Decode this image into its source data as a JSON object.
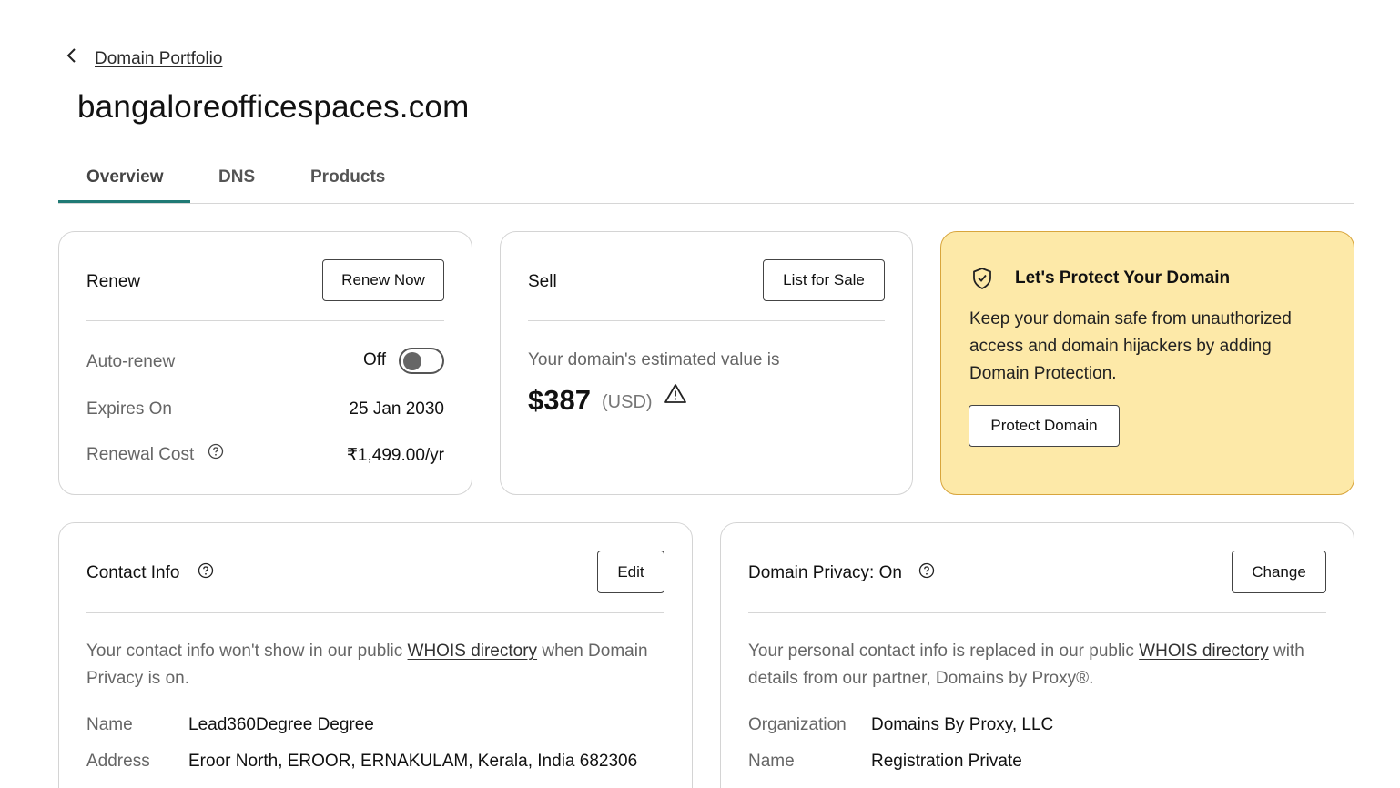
{
  "header": {
    "back_label": "Domain Portfolio",
    "domain_title": "bangaloreofficespaces.com"
  },
  "tabs": [
    {
      "label": "Overview",
      "active": true
    },
    {
      "label": "DNS",
      "active": false
    },
    {
      "label": "Products",
      "active": false
    }
  ],
  "renew": {
    "title": "Renew",
    "button": "Renew Now",
    "auto_renew_label": "Auto-renew",
    "auto_renew_state": "Off",
    "expires_label": "Expires On",
    "expires_value": "25 Jan 2030",
    "cost_label": "Renewal Cost",
    "cost_value": "₹1,499.00/yr"
  },
  "sell": {
    "title": "Sell",
    "button": "List for Sale",
    "estimate_text": "Your domain's estimated value is",
    "price": "$387",
    "currency": "(USD)"
  },
  "protect": {
    "title": "Let's Protect Your Domain",
    "description": "Keep your domain safe from unauthorized access and domain hijackers by adding Domain Protection.",
    "button": "Protect Domain"
  },
  "contact": {
    "title": "Contact Info",
    "button": "Edit",
    "text_before": "Your contact info won't show in our public ",
    "link": "WHOIS directory",
    "text_after": " when Domain Privacy is on.",
    "rows": [
      {
        "label": "Name",
        "value": "Lead360Degree Degree"
      },
      {
        "label": "Address",
        "value": "Eroor North, EROOR, ERNAKULAM, Kerala, India 682306"
      }
    ]
  },
  "privacy": {
    "title": "Domain Privacy: On",
    "button": "Change",
    "text_before": "Your personal contact info is replaced in our public ",
    "link": "WHOIS directory",
    "text_after": " with details from our partner, Domains by Proxy®.",
    "rows": [
      {
        "label": "Organization",
        "value": "Domains By Proxy, LLC"
      },
      {
        "label": "Name",
        "value": "Registration Private"
      }
    ]
  },
  "colors": {
    "accent": "#1f7a75",
    "protect_bg": "#fde9a8",
    "protect_border": "#d8a53c"
  }
}
